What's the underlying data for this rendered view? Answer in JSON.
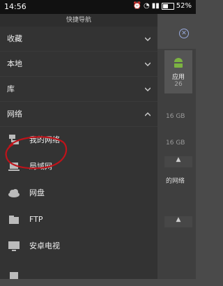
{
  "status": {
    "time": "14:56",
    "battery": "52%"
  },
  "drawer": {
    "title": "快捷导航",
    "categories": [
      "收藏",
      "本地",
      "库",
      "网络"
    ],
    "network_items": [
      "我的网络",
      "局域网",
      "网盘",
      "FTP",
      "安卓电视"
    ]
  },
  "background": {
    "app_card_label": "应用",
    "app_card_count": "26",
    "size_1": "16 GB",
    "size_2": "16 GB",
    "partial_text": "的网络"
  },
  "colors": {
    "highlight_oval": "#c0131a",
    "android_green": "#7cb342"
  }
}
